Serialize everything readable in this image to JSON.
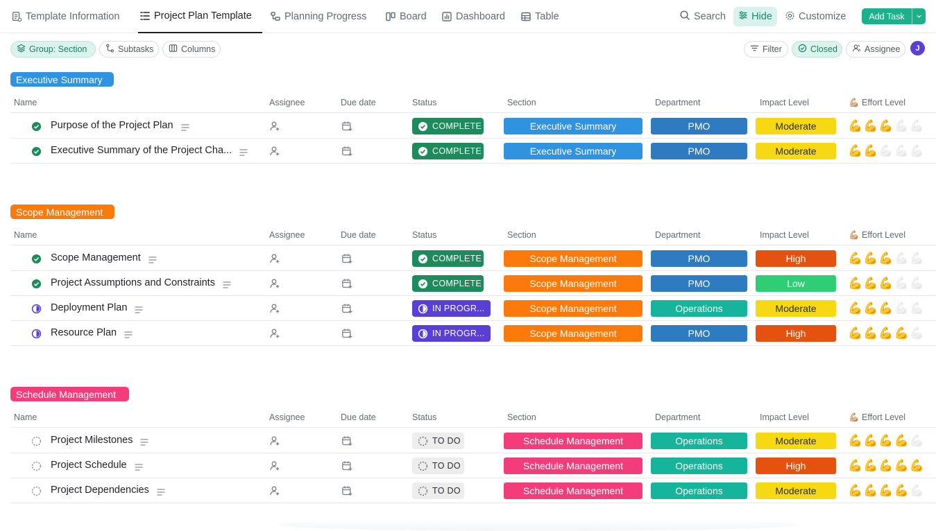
{
  "nav": {
    "tabs": [
      {
        "label": "Template Information",
        "icon": "doc-icon"
      },
      {
        "label": "Project Plan Template",
        "icon": "list-icon",
        "active": true
      },
      {
        "label": "Planning Progress",
        "icon": "gantt-icon"
      },
      {
        "label": "Board",
        "icon": "board-icon"
      },
      {
        "label": "Dashboard",
        "icon": "dashboard-icon"
      },
      {
        "label": "Table",
        "icon": "table-icon"
      }
    ],
    "search": "Search",
    "hide": "Hide",
    "customize": "Customize",
    "add_task": "Add Task"
  },
  "toolbar": {
    "group": "Group: Section",
    "subtasks": "Subtasks",
    "columns": "Columns",
    "filter": "Filter",
    "closed": "Closed",
    "assignee": "Assignee",
    "avatar": "J"
  },
  "columns": {
    "name": "Name",
    "assignee": "Assignee",
    "due": "Due date",
    "status": "Status",
    "section": "Section",
    "department": "Department",
    "impact": "Impact Level",
    "effort": "💪🏼 Effort Level"
  },
  "colors": {
    "executive": "#2f93e0",
    "scope": "#fb7a0b",
    "schedule": "#f23d7a",
    "pmo": "#2f7bbf",
    "operations": "#16b49a",
    "moderate": "#f7d913",
    "high": "#e5510e",
    "low": "#2fce76"
  },
  "groups": [
    {
      "label": "Executive Summary",
      "color": "#2f93e0",
      "rows": [
        {
          "name": "Purpose of the Project Plan",
          "status": "COMPLETE",
          "section": "Executive Summary",
          "department": "PMO",
          "impact": "Moderate",
          "effort": 3
        },
        {
          "name": "Executive Summary of the Project Cha...",
          "status": "COMPLETE",
          "section": "Executive Summary",
          "department": "PMO",
          "impact": "Moderate",
          "effort": 2
        }
      ]
    },
    {
      "label": "Scope Management",
      "color": "#fb7a0b",
      "rows": [
        {
          "name": "Scope Management",
          "status": "COMPLETE",
          "section": "Scope Management",
          "department": "PMO",
          "impact": "High",
          "effort": 3
        },
        {
          "name": "Project Assumptions and Constraints",
          "status": "COMPLETE",
          "section": "Scope Management",
          "department": "PMO",
          "impact": "Low",
          "effort": 3
        },
        {
          "name": "Deployment Plan",
          "status": "IN PROGR...",
          "section": "Scope Management",
          "department": "Operations",
          "impact": "Moderate",
          "effort": 3
        },
        {
          "name": "Resource Plan",
          "status": "IN PROGR...",
          "section": "Scope Management",
          "department": "PMO",
          "impact": "High",
          "effort": 4
        }
      ]
    },
    {
      "label": "Schedule Management",
      "color": "#f23d7a",
      "rows": [
        {
          "name": "Project Milestones",
          "status": "TO DO",
          "section": "Schedule Management",
          "department": "Operations",
          "impact": "Moderate",
          "effort": 4
        },
        {
          "name": "Project Schedule",
          "status": "TO DO",
          "section": "Schedule Management",
          "department": "Operations",
          "impact": "High",
          "effort": 5
        },
        {
          "name": "Project Dependencies",
          "status": "TO DO",
          "section": "Schedule Management",
          "department": "Operations",
          "impact": "Moderate",
          "effort": 4
        }
      ]
    }
  ]
}
